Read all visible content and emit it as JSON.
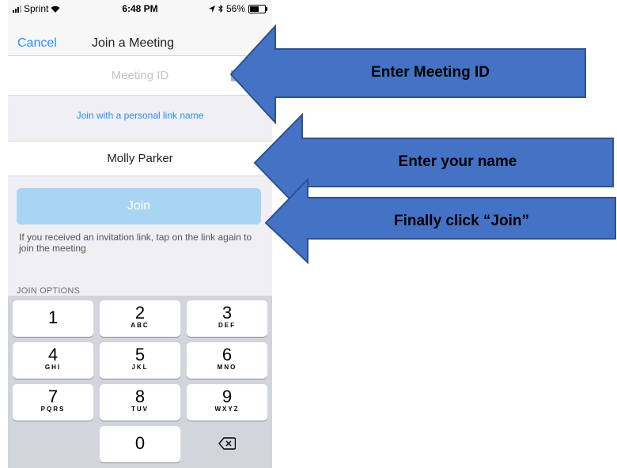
{
  "status_bar": {
    "carrier": "Sprint",
    "time": "6:48 PM",
    "battery": "56%"
  },
  "nav": {
    "cancel_label": "Cancel",
    "title": "Join a Meeting"
  },
  "meeting_id": {
    "placeholder": "Meeting ID",
    "value": ""
  },
  "personal_link_label": "Join with a personal link name",
  "name_field": {
    "value": "Molly Parker"
  },
  "join_button_label": "Join",
  "hint_text": "If you received an invitation link, tap on the link again to join the meeting",
  "join_options_label": "JOIN OPTIONS",
  "keypad": [
    {
      "digit": "1",
      "letters": ""
    },
    {
      "digit": "2",
      "letters": "ABC"
    },
    {
      "digit": "3",
      "letters": "DEF"
    },
    {
      "digit": "4",
      "letters": "GHI"
    },
    {
      "digit": "5",
      "letters": "JKL"
    },
    {
      "digit": "6",
      "letters": "MNO"
    },
    {
      "digit": "7",
      "letters": "PQRS"
    },
    {
      "digit": "8",
      "letters": "TUV"
    },
    {
      "digit": "9",
      "letters": "WXYZ"
    },
    {
      "digit": "0",
      "letters": ""
    }
  ],
  "callouts": {
    "meeting_id": "Enter Meeting ID",
    "name": "Enter your name",
    "join": "Finally click “Join”"
  },
  "colors": {
    "arrow_fill": "#4472c4",
    "arrow_stroke": "#2f528f",
    "accent_blue": "#2d8cff",
    "join_button": "#a9d5f3"
  }
}
